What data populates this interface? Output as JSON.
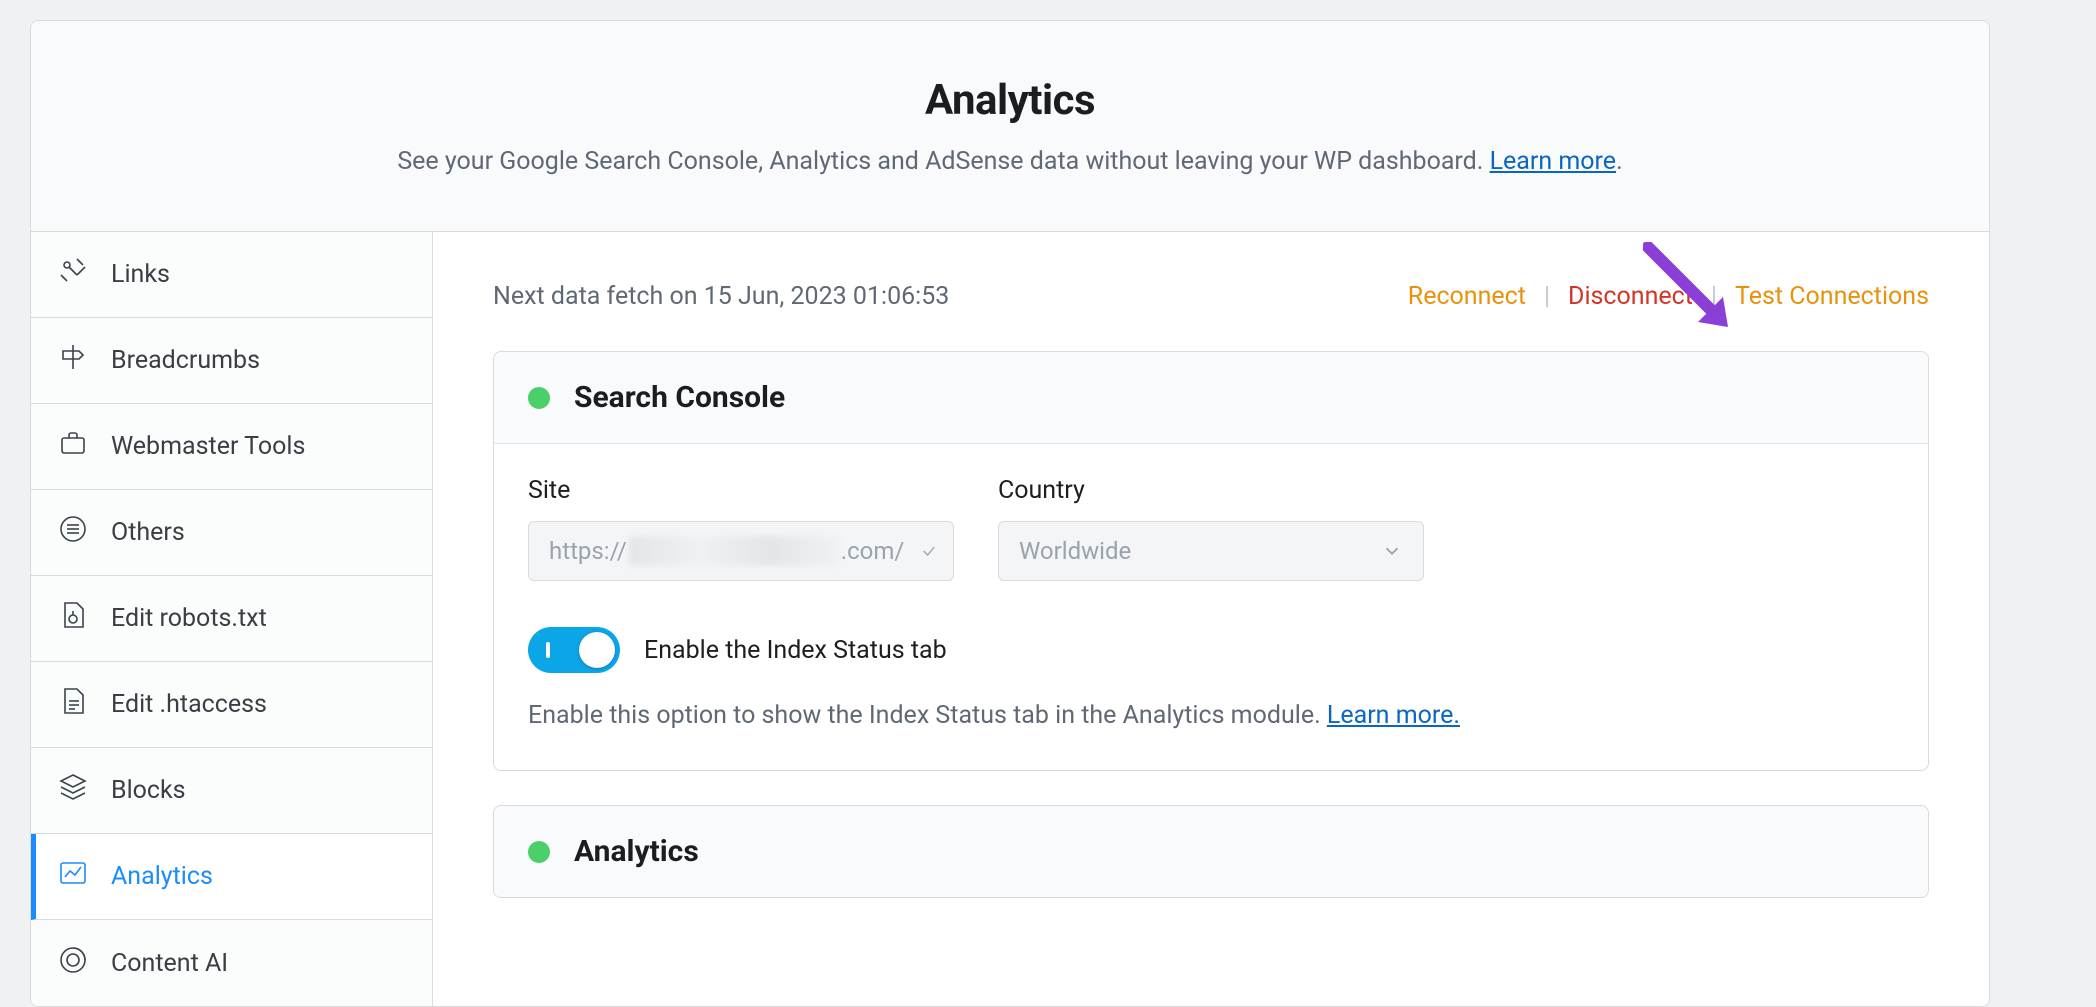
{
  "header": {
    "title": "Analytics",
    "subtitle_pre": "See your Google Search Console, Analytics and AdSense data without leaving your WP dashboard. ",
    "learn_more": "Learn more",
    "period": "."
  },
  "sidebar": {
    "items": [
      {
        "label": "Links"
      },
      {
        "label": "Breadcrumbs"
      },
      {
        "label": "Webmaster Tools"
      },
      {
        "label": "Others"
      },
      {
        "label": "Edit robots.txt"
      },
      {
        "label": "Edit .htaccess"
      },
      {
        "label": "Blocks"
      },
      {
        "label": "Analytics"
      },
      {
        "label": "Content AI"
      }
    ]
  },
  "top": {
    "next_fetch": "Next data fetch on 15 Jun, 2023 01:06:53",
    "reconnect": "Reconnect",
    "disconnect": "Disconnect",
    "test": "Test Connections",
    "sep": "|"
  },
  "search_console": {
    "title": "Search Console",
    "site_label": "Site",
    "site_prefix": "https://",
    "site_suffix": ".com/",
    "country_label": "Country",
    "country_value": "Worldwide",
    "toggle_label": "Enable the Index Status tab",
    "help_pre": "Enable this option to show the Index Status tab in the Analytics module. ",
    "help_link": "Learn more."
  },
  "analytics_card": {
    "title": "Analytics"
  }
}
